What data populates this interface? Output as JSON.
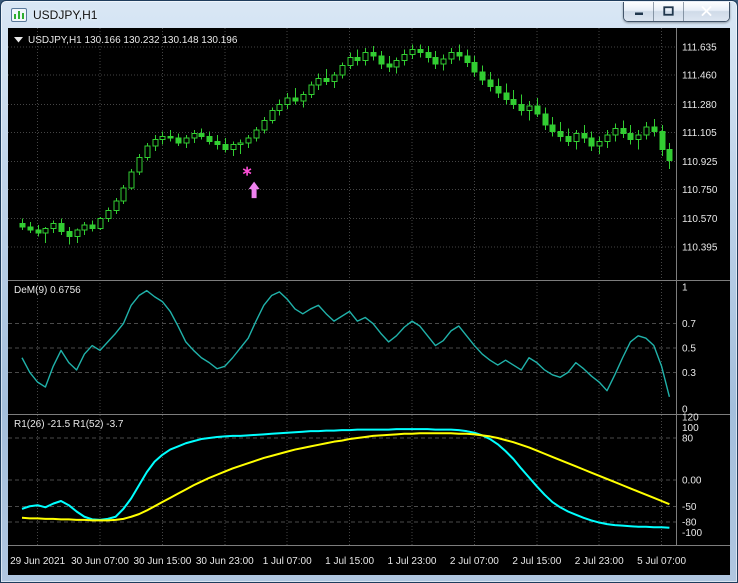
{
  "window": {
    "title": "USDJPY,H1"
  },
  "icons": {
    "window_icon": "chart-window-icon",
    "minimize": "minimize-icon",
    "maximize": "maximize-icon",
    "close": "close-icon",
    "ohlc_dropdown": "dropdown-triangle-icon",
    "buy_signal": "up-arrow-marker",
    "star_marker": "asterisk-marker"
  },
  "colors": {
    "background": "#000000",
    "grid": "#454545",
    "level": "#4a4a4a",
    "separator": "#7d7d7d",
    "text": "#e8e8e8",
    "candle": "#32cd32"
  },
  "time_axis": {
    "labels": [
      "29 Jun 2021",
      "30 Jun 07:00",
      "30 Jun 15:00",
      "30 Jun 23:00",
      "1 Jul 07:00",
      "1 Jul 15:00",
      "1 Jul 23:00",
      "2 Jul 07:00",
      "2 Jul 15:00",
      "2 Jul 23:00",
      "5 Jul 07:00"
    ],
    "bar_indices": [
      2,
      10,
      18,
      26,
      34,
      42,
      50,
      58,
      66,
      74,
      82
    ]
  },
  "chart_data": [
    {
      "type": "candlestick",
      "symbol_info": "USDJPY,H1 130.166 130.232 130.148 130.196",
      "ylim": [
        110.19,
        111.753
      ],
      "y_tick_labels": [
        "111.635",
        "111.460",
        "111.280",
        "111.105",
        "110.925",
        "110.750",
        "110.570",
        "110.395"
      ],
      "marks": {
        "bar": 29.5,
        "star_price": 110.865,
        "arrow_price": 110.8,
        "star_color": "#ff4fd8",
        "arrow_color": "#ee82ee"
      },
      "ohlc": [
        [
          110.54,
          110.57,
          110.5,
          110.52
        ],
        [
          110.52,
          110.55,
          110.48,
          110.5
        ],
        [
          110.5,
          110.53,
          110.46,
          110.48
        ],
        [
          110.48,
          110.52,
          110.42,
          110.51
        ],
        [
          110.51,
          110.56,
          110.48,
          110.54
        ],
        [
          110.54,
          110.57,
          110.47,
          110.49
        ],
        [
          110.49,
          110.52,
          110.41,
          110.46
        ],
        [
          110.46,
          110.51,
          110.42,
          110.5
        ],
        [
          110.5,
          110.55,
          110.47,
          110.53
        ],
        [
          110.53,
          110.56,
          110.49,
          110.51
        ],
        [
          110.51,
          110.58,
          110.5,
          110.57
        ],
        [
          110.57,
          110.64,
          110.55,
          110.62
        ],
        [
          110.62,
          110.7,
          110.6,
          110.68
        ],
        [
          110.68,
          110.78,
          110.66,
          110.76
        ],
        [
          110.76,
          110.88,
          110.75,
          110.86
        ],
        [
          110.86,
          110.97,
          110.84,
          110.95
        ],
        [
          110.95,
          111.04,
          110.93,
          111.02
        ],
        [
          111.02,
          111.09,
          110.99,
          111.06
        ],
        [
          111.06,
          111.11,
          111.03,
          111.08
        ],
        [
          111.08,
          111.12,
          111.05,
          111.07
        ],
        [
          111.07,
          111.1,
          111.02,
          111.04
        ],
        [
          111.04,
          111.09,
          111.01,
          111.07
        ],
        [
          111.07,
          111.12,
          111.04,
          111.1
        ],
        [
          111.1,
          111.13,
          111.06,
          111.08
        ],
        [
          111.08,
          111.11,
          111.03,
          111.05
        ],
        [
          111.05,
          111.09,
          111.0,
          111.03
        ],
        [
          111.03,
          111.07,
          110.98,
          111.0
        ],
        [
          111.0,
          111.05,
          110.96,
          111.03
        ],
        [
          111.03,
          111.06,
          110.97,
          111.04
        ],
        [
          111.04,
          111.09,
          111.01,
          111.07
        ],
        [
          111.07,
          111.14,
          111.05,
          111.12
        ],
        [
          111.12,
          111.2,
          111.1,
          111.18
        ],
        [
          111.18,
          111.26,
          111.16,
          111.24
        ],
        [
          111.24,
          111.31,
          111.21,
          111.28
        ],
        [
          111.28,
          111.35,
          111.25,
          111.32
        ],
        [
          111.32,
          111.38,
          111.28,
          111.3
        ],
        [
          111.3,
          111.36,
          111.26,
          111.34
        ],
        [
          111.34,
          111.42,
          111.32,
          111.4
        ],
        [
          111.4,
          111.47,
          111.37,
          111.44
        ],
        [
          111.44,
          111.5,
          111.4,
          111.42
        ],
        [
          111.42,
          111.48,
          111.38,
          111.46
        ],
        [
          111.46,
          111.54,
          111.44,
          111.52
        ],
        [
          111.52,
          111.6,
          111.5,
          111.57
        ],
        [
          111.57,
          111.62,
          111.52,
          111.55
        ],
        [
          111.55,
          111.63,
          111.52,
          111.6
        ],
        [
          111.6,
          111.64,
          111.55,
          111.58
        ],
        [
          111.58,
          111.61,
          111.5,
          111.53
        ],
        [
          111.53,
          111.58,
          111.48,
          111.51
        ],
        [
          111.51,
          111.57,
          111.47,
          111.55
        ],
        [
          111.55,
          111.62,
          111.52,
          111.59
        ],
        [
          111.59,
          111.65,
          111.56,
          111.62
        ],
        [
          111.62,
          111.65,
          111.57,
          111.6
        ],
        [
          111.6,
          111.64,
          111.54,
          111.57
        ],
        [
          111.57,
          111.61,
          111.5,
          111.53
        ],
        [
          111.53,
          111.59,
          111.49,
          111.56
        ],
        [
          111.56,
          111.63,
          111.53,
          111.6
        ],
        [
          111.6,
          111.65,
          111.55,
          111.58
        ],
        [
          111.58,
          111.62,
          111.51,
          111.54
        ],
        [
          111.54,
          111.58,
          111.45,
          111.48
        ],
        [
          111.48,
          111.52,
          111.4,
          111.43
        ],
        [
          111.43,
          111.48,
          111.36,
          111.39
        ],
        [
          111.39,
          111.44,
          111.32,
          111.35
        ],
        [
          111.35,
          111.41,
          111.28,
          111.31
        ],
        [
          111.31,
          111.37,
          111.25,
          111.28
        ],
        [
          111.28,
          111.34,
          111.21,
          111.24
        ],
        [
          111.24,
          111.3,
          111.18,
          111.27
        ],
        [
          111.27,
          111.32,
          111.2,
          111.22
        ],
        [
          111.22,
          111.26,
          111.12,
          111.15
        ],
        [
          111.15,
          111.2,
          111.08,
          111.11
        ],
        [
          111.11,
          111.17,
          111.05,
          111.08
        ],
        [
          111.08,
          111.13,
          111.02,
          111.05
        ],
        [
          111.05,
          111.12,
          111.0,
          111.1
        ],
        [
          111.1,
          111.15,
          111.04,
          111.07
        ],
        [
          111.07,
          111.11,
          110.99,
          111.02
        ],
        [
          111.02,
          111.08,
          110.97,
          111.05
        ],
        [
          111.05,
          111.12,
          111.01,
          111.09
        ],
        [
          111.09,
          111.16,
          111.05,
          111.13
        ],
        [
          111.13,
          111.18,
          111.07,
          111.1
        ],
        [
          111.1,
          111.15,
          111.03,
          111.06
        ],
        [
          111.06,
          111.12,
          111.0,
          111.09
        ],
        [
          111.09,
          111.17,
          111.06,
          111.14
        ],
        [
          111.14,
          111.19,
          111.08,
          111.11
        ],
        [
          111.11,
          111.15,
          110.96,
          111.0
        ],
        [
          111.0,
          111.04,
          110.88,
          110.93
        ]
      ]
    },
    {
      "type": "line",
      "label": "DeM(9) 0.6756",
      "ylim": [
        -0.041,
        1.049
      ],
      "y_tick_labels": [
        "1",
        "0.7",
        "0.5",
        "0.3",
        "0"
      ],
      "levels": [
        0.7,
        0.5,
        0.3
      ],
      "color": "#20b2aa",
      "values": [
        0.42,
        0.3,
        0.22,
        0.18,
        0.35,
        0.48,
        0.38,
        0.32,
        0.45,
        0.52,
        0.48,
        0.55,
        0.62,
        0.7,
        0.85,
        0.93,
        0.97,
        0.92,
        0.88,
        0.8,
        0.68,
        0.55,
        0.48,
        0.42,
        0.38,
        0.33,
        0.35,
        0.42,
        0.5,
        0.58,
        0.72,
        0.85,
        0.93,
        0.96,
        0.9,
        0.82,
        0.78,
        0.82,
        0.85,
        0.78,
        0.72,
        0.76,
        0.8,
        0.72,
        0.75,
        0.7,
        0.62,
        0.55,
        0.6,
        0.67,
        0.72,
        0.68,
        0.6,
        0.52,
        0.56,
        0.64,
        0.68,
        0.6,
        0.52,
        0.45,
        0.4,
        0.36,
        0.4,
        0.36,
        0.32,
        0.42,
        0.38,
        0.32,
        0.28,
        0.26,
        0.3,
        0.38,
        0.33,
        0.27,
        0.22,
        0.15,
        0.28,
        0.42,
        0.55,
        0.6,
        0.58,
        0.52,
        0.35,
        0.1
      ]
    },
    {
      "type": "line",
      "label": "R1(26) -21.5  R1(52) -3.7",
      "ylim": [
        -123.8,
        123.8
      ],
      "y_tick_labels": [
        "120",
        "100",
        "80",
        "0.00",
        "-50",
        "-80",
        "-100"
      ],
      "levels": [
        80,
        0,
        -50,
        -80
      ],
      "series": [
        {
          "name": "R1(26)",
          "color": "#00ffff",
          "values": [
            -55,
            -50,
            -48,
            -52,
            -45,
            -40,
            -48,
            -60,
            -70,
            -75,
            -76,
            -74,
            -70,
            -55,
            -35,
            -10,
            15,
            35,
            48,
            58,
            64,
            70,
            74,
            78,
            80,
            82,
            83,
            84,
            84,
            85,
            86,
            87,
            88,
            89,
            90,
            91,
            92,
            93,
            93,
            94,
            94,
            95,
            95,
            96,
            96,
            96,
            96,
            96,
            97,
            97,
            97,
            97,
            97,
            96,
            96,
            96,
            95,
            93,
            90,
            85,
            78,
            68,
            55,
            40,
            22,
            5,
            -12,
            -28,
            -42,
            -52,
            -60,
            -66,
            -72,
            -77,
            -81,
            -84,
            -86,
            -87,
            -88,
            -89,
            -89,
            -90,
            -90,
            -91
          ]
        },
        {
          "name": "R1(52)",
          "color": "#ffff00",
          "values": [
            -72,
            -73,
            -73,
            -74,
            -74,
            -75,
            -75,
            -76,
            -76,
            -77,
            -77,
            -77,
            -76,
            -74,
            -70,
            -65,
            -58,
            -50,
            -42,
            -34,
            -26,
            -18,
            -10,
            -3,
            4,
            10,
            16,
            22,
            27,
            32,
            37,
            42,
            46,
            50,
            54,
            58,
            61,
            64,
            67,
            70,
            73,
            75,
            78,
            80,
            82,
            84,
            85,
            86,
            87,
            88,
            88,
            89,
            89,
            89,
            89,
            89,
            88,
            88,
            87,
            85,
            83,
            80,
            76,
            72,
            67,
            62,
            56,
            50,
            44,
            38,
            32,
            26,
            20,
            14,
            8,
            2,
            -4,
            -10,
            -16,
            -22,
            -28,
            -34,
            -40,
            -46
          ]
        }
      ]
    }
  ]
}
